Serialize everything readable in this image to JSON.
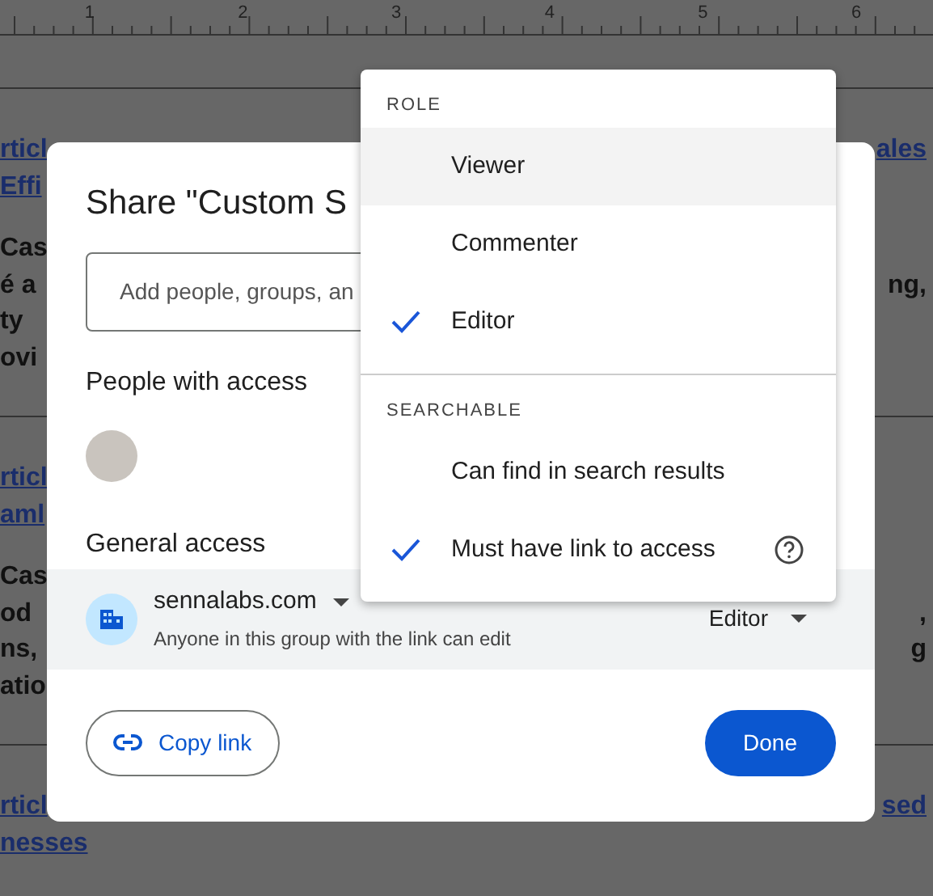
{
  "ruler": {
    "numbers": [
      "1",
      "2",
      "3",
      "4",
      "5",
      "6"
    ]
  },
  "document": {
    "blocks": [
      {
        "kind": "link",
        "lines": [
          {
            "left": "rticl",
            "right": "ales"
          },
          {
            "left": "Effi"
          }
        ]
      },
      {
        "kind": "text",
        "lines": [
          {
            "left": "Cas"
          },
          {
            "left": "é a",
            "right": "ng,"
          },
          {
            "left": "ty"
          },
          {
            "left": "ovi"
          }
        ]
      },
      {
        "kind": "divider"
      },
      {
        "kind": "link",
        "lines": [
          {
            "left": "rticl"
          },
          {
            "left": "aml"
          }
        ]
      },
      {
        "kind": "text",
        "lines": [
          {
            "left": "Cas"
          },
          {
            "left": "od",
            "right": ","
          },
          {
            "left": "ns,",
            "right": "g"
          },
          {
            "left": "atio"
          }
        ]
      },
      {
        "kind": "divider"
      },
      {
        "kind": "link",
        "lines": [
          {
            "left": "rticl",
            "right": "sed"
          },
          {
            "left": "nesses"
          }
        ]
      }
    ]
  },
  "dialog": {
    "title": "Share \"Custom S",
    "add_field": {
      "placeholder": "Add people, groups, an"
    },
    "people_heading": "People with access",
    "general_heading": "General access",
    "general_access": {
      "domain": "sennalabs.com",
      "description": "Anyone in this group with the link can edit",
      "role": "Editor"
    },
    "copy_link": "Copy link",
    "done": "Done"
  },
  "menu": {
    "sections": [
      {
        "heading": "ROLE",
        "items": [
          {
            "label": "Viewer",
            "checked": false,
            "hovered": true,
            "help": false
          },
          {
            "label": "Commenter",
            "checked": false,
            "hovered": false,
            "help": false
          },
          {
            "label": "Editor",
            "checked": true,
            "hovered": false,
            "help": false
          }
        ]
      },
      {
        "heading": "SEARCHABLE",
        "items": [
          {
            "label": "Can find in search results",
            "checked": false,
            "hovered": false,
            "help": false
          },
          {
            "label": "Must have link to access",
            "checked": true,
            "hovered": false,
            "help": true
          }
        ]
      }
    ]
  }
}
